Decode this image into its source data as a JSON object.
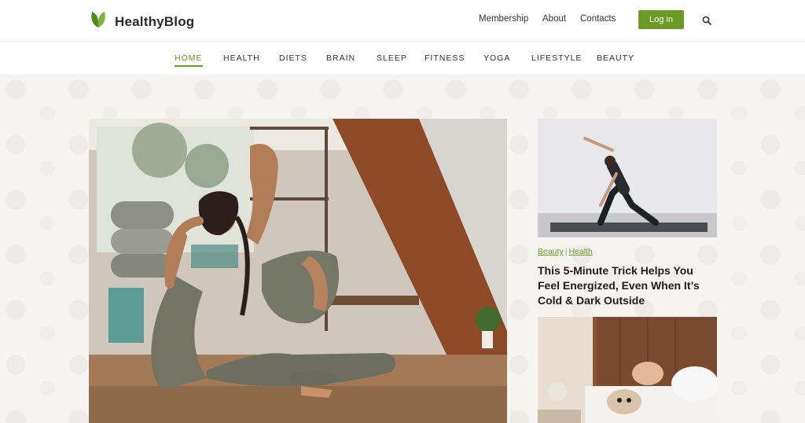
{
  "header": {
    "logo_text": "HealthyBlog",
    "logo_icon": "leaf-icon",
    "links": [
      "Membership",
      "About",
      "Contacts"
    ],
    "login_label": "Log in",
    "search_icon": "search-icon",
    "accent_color": "#6a9b24"
  },
  "nav": {
    "items": [
      "HOME",
      "HEALTH",
      "DIETS",
      "BRAIN",
      "SLEEP",
      "FITNESS",
      "YOGA",
      "LIFESTYLE",
      "BEAUTY"
    ],
    "active": "HOME"
  },
  "article": {
    "tags": [
      "Beauty",
      "Health"
    ],
    "tag_separator": "|",
    "title": "This 5-Minute Trick Helps You Feel Energized, Even When It’s Cold & Dark Outside"
  }
}
